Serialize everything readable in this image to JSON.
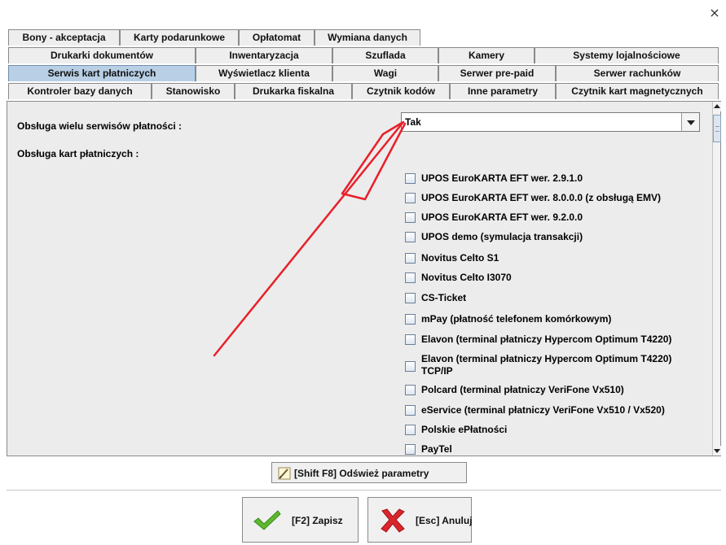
{
  "window": {
    "close_symbol": "×"
  },
  "tabs": {
    "row1": [
      "Bony - akceptacja",
      "Karty podarunkowe",
      "Opłatomat",
      "Wymiana danych"
    ],
    "row2": [
      "Drukarki dokumentów",
      "Inwentaryzacja",
      "Szuflada",
      "Kamery",
      "Systemy lojalnościowe"
    ],
    "row3": [
      "Serwis kart płatniczych",
      "Wyświetlacz klienta",
      "Wagi",
      "Serwer pre-paid",
      "Serwer rachunków"
    ],
    "row4": [
      "Kontroler bazy danych",
      "Stanowisko",
      "Drukarka fiskalna",
      "Czytnik kodów",
      "Inne parametry",
      "Czytnik kart magnetycznych"
    ],
    "active": "Serwis kart płatniczych"
  },
  "settings": {
    "multi_service_label": "Obsługa wielu serwisów płatności :",
    "multi_service_value": "Tak",
    "cards_label": "Obsługa kart płatniczych :",
    "card_options": [
      {
        "label": "UPOS EuroKARTA EFT wer. 2.9.1.0",
        "checked": false
      },
      {
        "label": "UPOS EuroKARTA EFT wer. 8.0.0.0 (z obsługą EMV)",
        "checked": false
      },
      {
        "label": "UPOS EuroKARTA EFT wer. 9.2.0.0",
        "checked": false
      },
      {
        "label": "UPOS demo (symulacja transakcji)",
        "checked": false
      },
      {
        "label": "Novitus Celto S1",
        "checked": false
      },
      {
        "label": "Novitus Celto I3070",
        "checked": false
      },
      {
        "label": "CS-Ticket",
        "checked": false
      },
      {
        "label": "mPay (płatność telefonem komórkowym)",
        "checked": false
      },
      {
        "label": "Elavon (terminal płatniczy Hypercom Optimum T4220)",
        "checked": false
      },
      {
        "label": "Elavon (terminal płatniczy Hypercom Optimum T4220)",
        "label2": "TCP/IP",
        "checked": false
      },
      {
        "label": "Polcard (terminal płatniczy VeriFone Vx510)",
        "checked": false
      },
      {
        "label": "eService (terminal płatniczy VeriFone Vx510 / Vx520)",
        "checked": false
      },
      {
        "label": "Polskie ePłatności",
        "checked": false
      },
      {
        "label": "PayTel",
        "checked": false
      }
    ]
  },
  "buttons": {
    "refresh": "[Shift F8] Odśwież parametry",
    "save": "[F2] Zapisz",
    "cancel": "[Esc] Anuluj"
  },
  "colors": {
    "active_tab": "#b8cfe5",
    "annotation_arrow": "#e8202a",
    "save_check": "#5cb82e",
    "cancel_x": "#d9262c"
  },
  "icons": {
    "refresh": "pencil-ruler-icon",
    "save": "green-check-icon",
    "cancel": "red-x-icon",
    "close": "close-icon"
  }
}
